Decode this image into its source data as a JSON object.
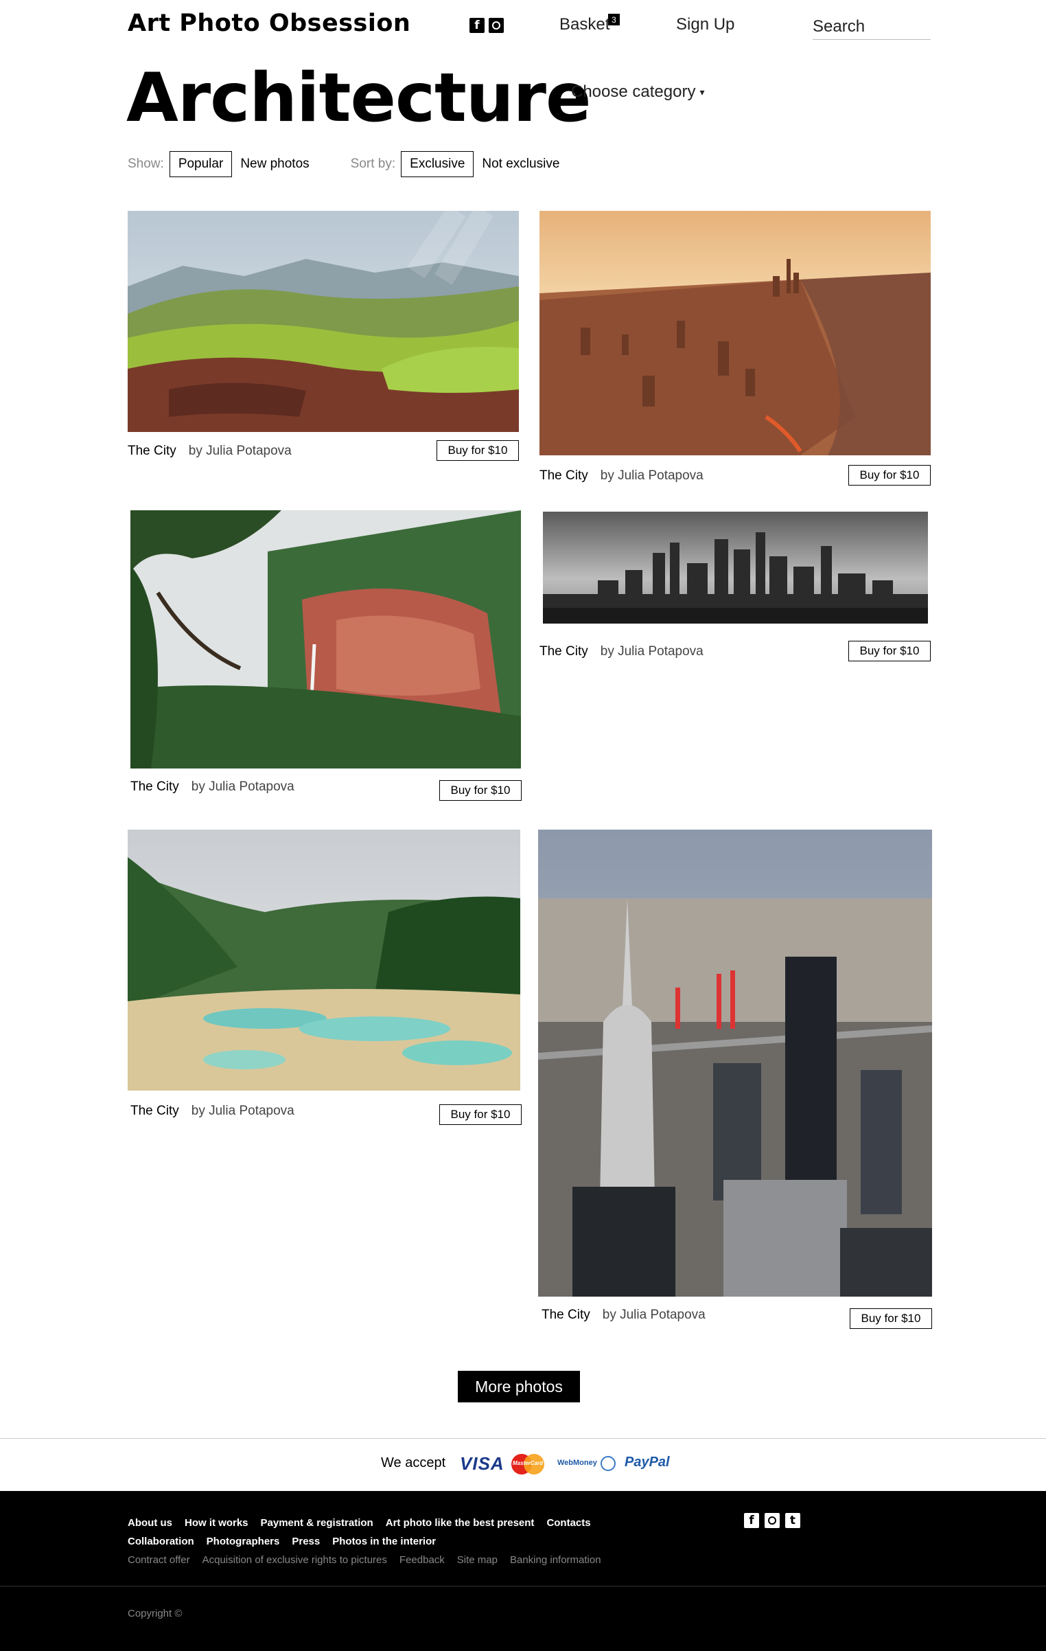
{
  "header": {
    "logo": "Art Photo Obsession",
    "social": [
      {
        "icon": "facebook-icon",
        "glyph": "f"
      },
      {
        "icon": "instagram-icon",
        "glyph": ""
      }
    ],
    "basket_label": "Basket",
    "basket_count": "3",
    "signup_label": "Sign Up",
    "search_placeholder": "Search"
  },
  "page": {
    "title": "Architecture",
    "category_label": "Choose category",
    "category_arrow": "▾"
  },
  "filters": {
    "show_label": "Show:",
    "show_options": [
      "Popular",
      "New photos"
    ],
    "sort_label": "Sort by:",
    "sort_options": [
      "Exclusive",
      "Not exclusive"
    ]
  },
  "photos": [
    {
      "title": "The City",
      "author": "by Julia Potapova",
      "buy": "Buy for $10",
      "scene": "green terraced hills"
    },
    {
      "title": "The City",
      "author": "by Julia Potapova",
      "buy": "Buy for $10",
      "scene": "sunset aerial city"
    },
    {
      "title": "The City",
      "author": "by Julia Potapova",
      "buy": "Buy for $10",
      "scene": "waterfall red cliffs"
    },
    {
      "title": "The City",
      "author": "by Julia Potapova",
      "buy": "Buy for $10",
      "scene": "black and white skyline"
    },
    {
      "title": "The City",
      "author": "by Julia Potapova",
      "buy": "Buy for $10",
      "scene": "turquoise pools forest"
    },
    {
      "title": "The City",
      "author": "by Julia Potapova",
      "buy": "Buy for $10",
      "scene": "skyscrapers chrysler"
    }
  ],
  "more_label": "More photos",
  "payments": {
    "label": "We accept",
    "visa": "VISA",
    "mastercard": "MasterCard",
    "webmoney": "WebMoney",
    "paypal": "PayPal"
  },
  "footer": {
    "row1": [
      "About us",
      "How it works",
      "Payment & registration",
      "Art photo like the best present",
      "Contacts"
    ],
    "row2": [
      "Collaboration",
      "Photographers",
      "Press",
      "Photos in the interior"
    ],
    "row3": [
      "Contract offer",
      "Acquisition of exclusive rights to pictures",
      "Feedback",
      "Site map",
      "Banking information"
    ],
    "social": [
      {
        "icon": "facebook-icon",
        "glyph": "f"
      },
      {
        "icon": "instagram-icon",
        "glyph": ""
      },
      {
        "icon": "tumblr-icon",
        "glyph": "t"
      }
    ],
    "copyright": "Copyright ©"
  },
  "colors": {
    "accent": "#000000",
    "footer_bg": "#000000",
    "muted_text": "#888888"
  }
}
